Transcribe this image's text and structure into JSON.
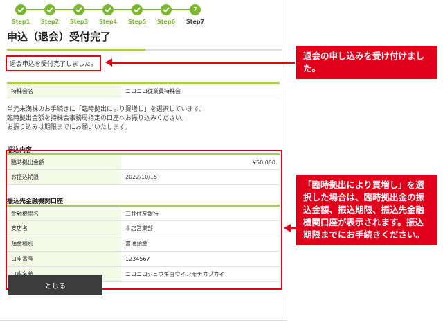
{
  "steps": [
    "Step1",
    "Step2",
    "Step3",
    "Step4",
    "Step5",
    "Step6",
    "Step7"
  ],
  "current_step_number": "7",
  "page_title": "申込（退会）受付完了",
  "complete_message": "退会申込を受付完了しました。",
  "member": {
    "label": "持株会名",
    "value": "ニコニコ従業員持株会"
  },
  "notice_lines": [
    "単元未満株のお手続きに「臨時拠出により買増し」を選択しています。",
    "臨時拠出金額を持株会事務局指定の口座へお振り込みください。",
    "お振り込みは期限までにお願いいたします。"
  ],
  "transfer": {
    "heading": "振込内容",
    "rows": [
      {
        "label": "臨時拠出金額",
        "value": "¥50,000"
      },
      {
        "label": "お振込期限",
        "value": "2022/10/15"
      }
    ]
  },
  "bank": {
    "heading": "振込先金融機関口座",
    "rows": [
      {
        "label": "金融機関名",
        "value": "三井住友銀行"
      },
      {
        "label": "支店名",
        "value": "本店営業部"
      },
      {
        "label": "預金種別",
        "value": "普通預金"
      },
      {
        "label": "口座番号",
        "value": "1234567"
      },
      {
        "label": "口座名義",
        "value": "ニコニコジュウギョウインモチカブカイ"
      }
    ]
  },
  "close_button": "とじる",
  "callouts": {
    "top": "退会の申し込みを受け付けました。",
    "bottom": "「臨時拠出により買増し」を選択した場合は、臨時拠出金の振込金額、振込期限、振込先金融機関口座が表示されます。振込期限までにお手続きください。"
  },
  "colors": {
    "accent_green": "#7cb82f",
    "callout_red": "#e0001b",
    "button_dark": "#3b3b3b"
  }
}
